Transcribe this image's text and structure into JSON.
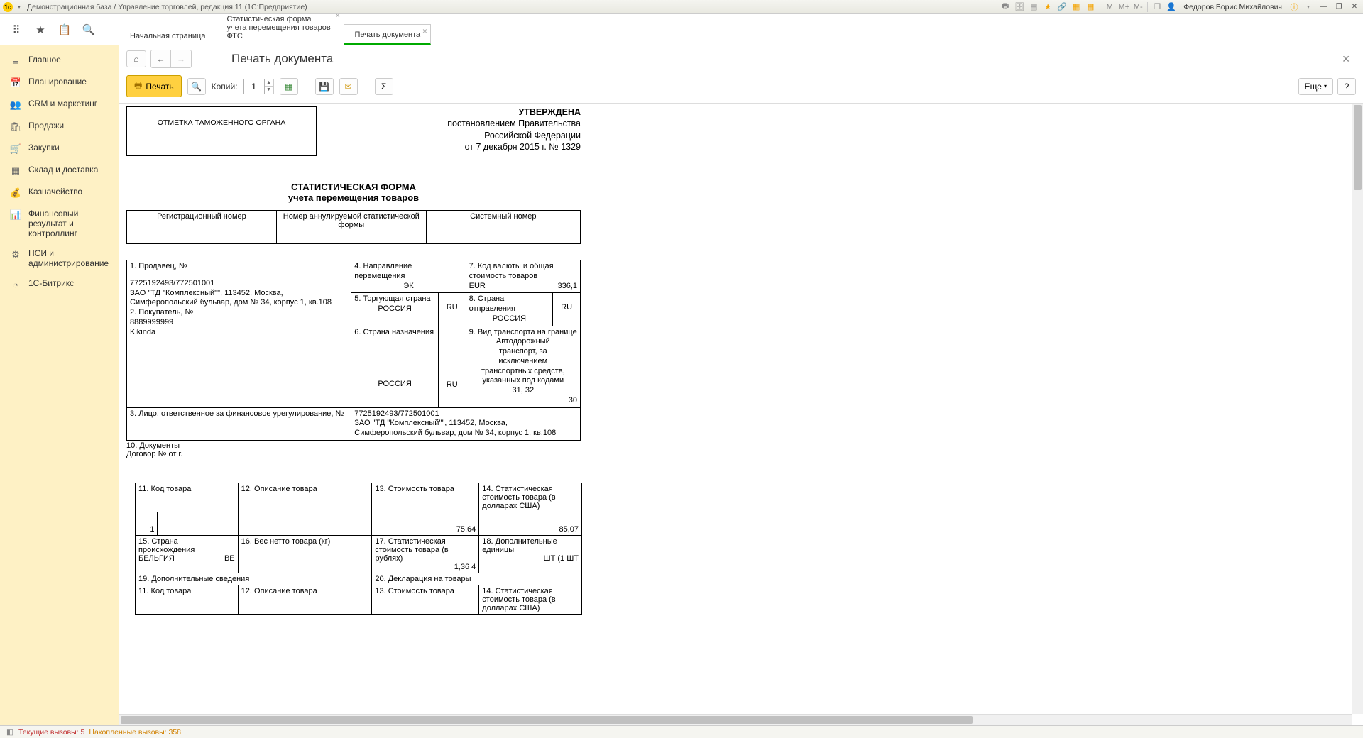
{
  "titlebar": {
    "text": "Демонстрационная база / Управление торговлей, редакция 11  (1С:Предприятие)",
    "user": "Федоров Борис Михайлович",
    "m_labels": [
      "M",
      "M+",
      "M-"
    ]
  },
  "tabs": [
    {
      "label": "Начальная страница"
    },
    {
      "label": "Статистическая форма учета перемещения товаров ФТС"
    },
    {
      "label": "Печать документа"
    }
  ],
  "sidebar": [
    {
      "icon": "≡",
      "label": "Главное"
    },
    {
      "icon": "📅",
      "label": "Планирование"
    },
    {
      "icon": "👥",
      "label": "CRM и маркетинг"
    },
    {
      "icon": "🛍",
      "label": "Продажи"
    },
    {
      "icon": "🛒",
      "label": "Закупки"
    },
    {
      "icon": "▦",
      "label": "Склад и доставка"
    },
    {
      "icon": "💰",
      "label": "Казначейство"
    },
    {
      "icon": "📊",
      "label": "Финансовый результат и контроллинг"
    },
    {
      "icon": "⚙",
      "label": "НСИ и администрирование"
    },
    {
      "icon": "◔",
      "label": "1С-Битрикс"
    }
  ],
  "page": {
    "title": "Печать документа"
  },
  "toolbar": {
    "print": "Печать",
    "copies_label": "Копий:",
    "copies_value": "1",
    "more": "Еще"
  },
  "doc": {
    "stamp": "ОТМЕТКА ТАМОЖЕННОГО ОРГАНА",
    "approved_1": "УТВЕРЖДЕНА",
    "approved_2": "постановлением Правительства",
    "approved_3": "Российской Федерации",
    "approved_4": "от 7 декабря 2015 г. № 1329",
    "title_1": "СТАТИСТИЧЕСКАЯ ФОРМА",
    "title_2": "учета перемещения товаров",
    "reg_headers": [
      "Регистрационный номер",
      "Номер аннулируемой статистической формы",
      "Системный номер"
    ],
    "c1_label": "1. Продавец, №",
    "c1_inn": "7725192493/772501001",
    "c1_addr": "ЗАО \"ТД \"Комплексный\"\", 113452, Москва, Симферопольский бульвар, дом № 34, корпус 1, кв.108",
    "c2_label": "2. Покупатель, №",
    "c2_inn": "8889999999",
    "c2_name": "Kikinda",
    "c4_label": "4. Направление перемещения",
    "c4_val": "ЭК",
    "c5_label": "5. Торгующая страна",
    "c5_country": "РОССИЯ",
    "c5_code": "RU",
    "c6_label": "6. Страна назначения",
    "c6_country": "РОССИЯ",
    "c6_code": "RU",
    "c7_label": "7. Код валюты и общая стоимость товаров",
    "c7_cur": "EUR",
    "c7_val": "336,1",
    "c8_label": "8. Страна отправления",
    "c8_country": "РОССИЯ",
    "c8_code": "RU",
    "c9_label": "9. Вид транспорта на границе",
    "c9_text": "Автодорожный транспорт, за исключением транспортных средств, указанных под кодами 31, 32",
    "c9_code": "30",
    "c3_label": "3. Лицо, ответственное за финансовое урегулирование, №",
    "c3_inn": "7725192493/772501001",
    "c3_addr": "ЗАО \"ТД \"Комплексный\"\", 113452, Москва, Симферопольский бульвар, дом № 34, корпус 1, кв.108",
    "c10_label": "10. Документы",
    "c10_text": "Договор №   от   г.",
    "g11": "11. Код товара",
    "g12": "12. Описание товара",
    "g13": "13. Стоимость товара",
    "g14": "14. Статистическая стоимость товара (в долларах США)",
    "g15": "15. Страна происхождения",
    "g16": "16. Вес нетто товара (кг)",
    "g17": "17. Статистическая стоимость товара (в рублях)",
    "g18": "18. Дополнительные единицы",
    "g19": "19. Дополнительные сведения",
    "g20": "20. Декларация на товары",
    "row1_idx": "1",
    "row1_cost": "75,64",
    "row1_usd": "85,07",
    "row1_country": "БЕЛЬГИЯ",
    "row1_ccode": "BE",
    "row1_rub": "1,36",
    "row1_qty": "4",
    "row1_unit": "ШТ (1 ШТ"
  },
  "status": {
    "p1": "Текущие вызовы: 5",
    "p2": "Накопленные вызовы: 358"
  }
}
